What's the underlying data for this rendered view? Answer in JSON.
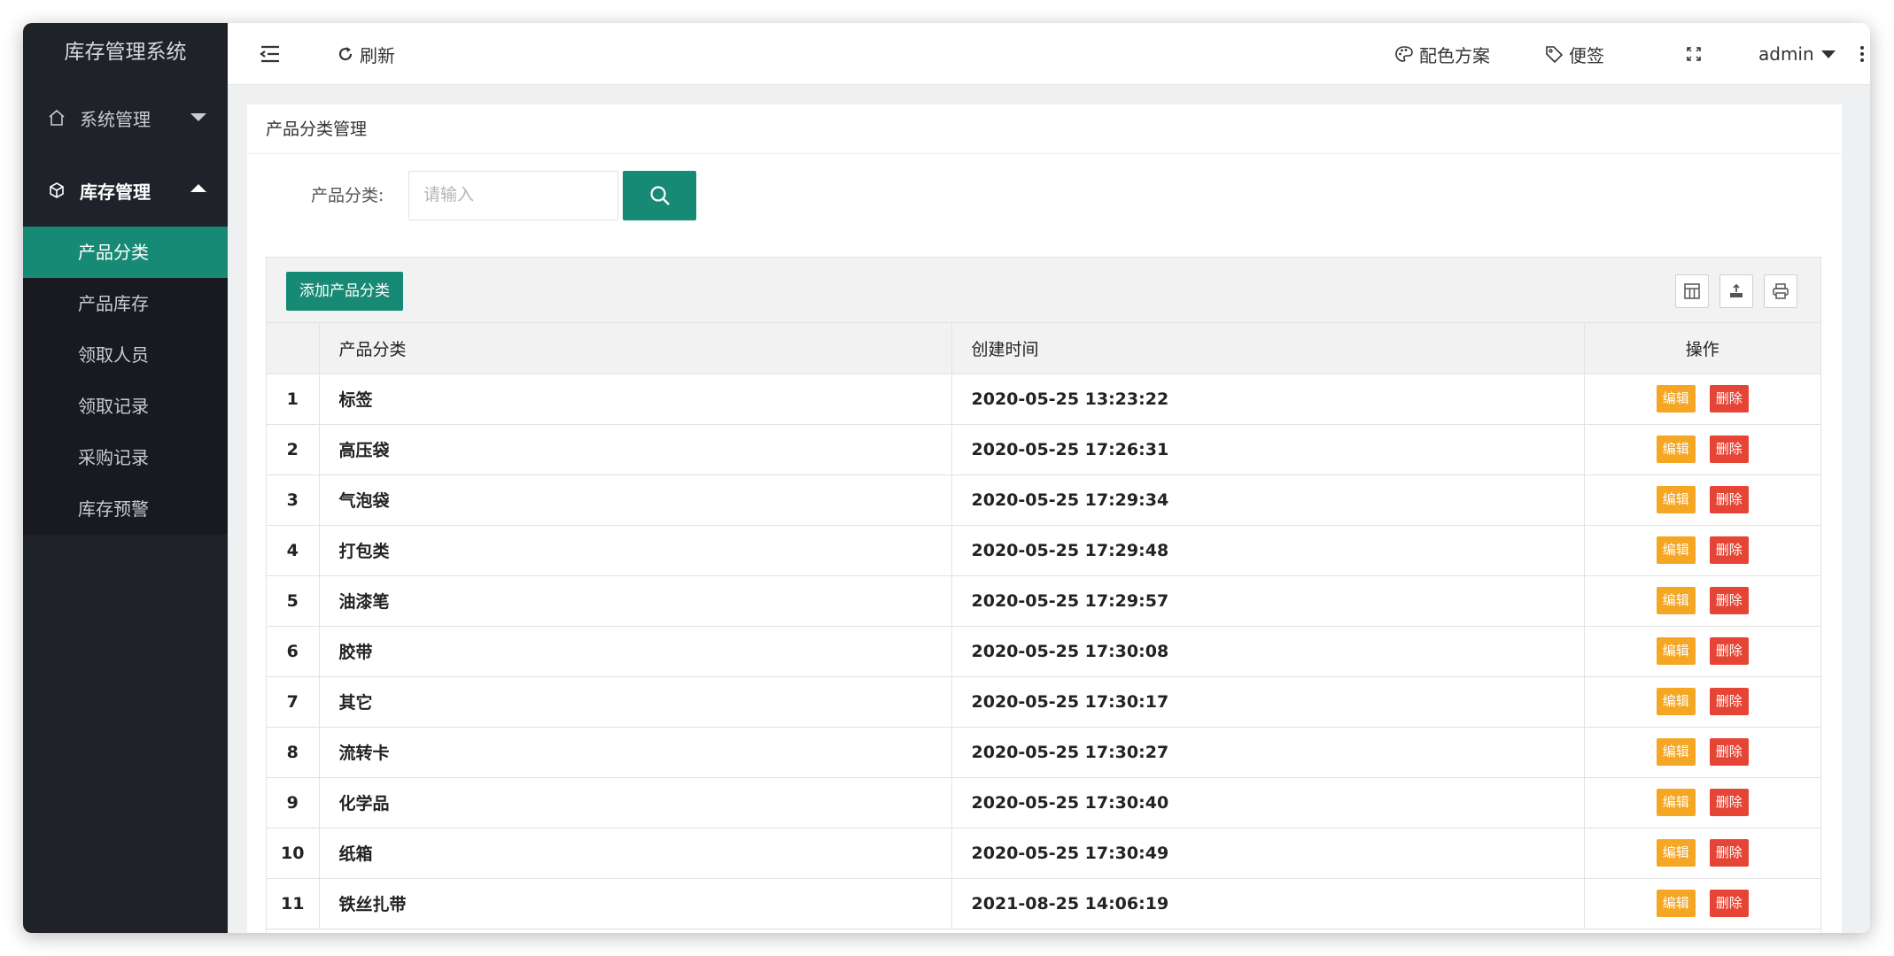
{
  "app": {
    "title": "库存管理系统"
  },
  "sidebar": {
    "groups": [
      {
        "label": "系统管理",
        "icon": "home-icon",
        "expanded": false
      },
      {
        "label": "库存管理",
        "icon": "cube-icon",
        "expanded": true,
        "items": [
          {
            "label": "产品分类",
            "active": true
          },
          {
            "label": "产品库存"
          },
          {
            "label": "领取人员"
          },
          {
            "label": "领取记录"
          },
          {
            "label": "采购记录"
          },
          {
            "label": "库存预警"
          }
        ]
      }
    ]
  },
  "header": {
    "refresh_label": "刷新",
    "theme_label": "配色方案",
    "notes_label": "便签",
    "user_label": "admin"
  },
  "panel": {
    "title": "产品分类管理"
  },
  "search": {
    "label": "产品分类:",
    "placeholder": "请输入"
  },
  "toolbar": {
    "add_label": "添加产品分类"
  },
  "table": {
    "columns": [
      "",
      "产品分类",
      "创建时间",
      "操作"
    ],
    "rows": [
      {
        "num": "1",
        "name": "标签",
        "created": "2020-05-25 13:23:22"
      },
      {
        "num": "2",
        "name": "高压袋",
        "created": "2020-05-25 17:26:31"
      },
      {
        "num": "3",
        "name": "气泡袋",
        "created": "2020-05-25 17:29:34"
      },
      {
        "num": "4",
        "name": "打包类",
        "created": "2020-05-25 17:29:48"
      },
      {
        "num": "5",
        "name": "油漆笔",
        "created": "2020-05-25 17:29:57"
      },
      {
        "num": "6",
        "name": "胶带",
        "created": "2020-05-25 17:30:08"
      },
      {
        "num": "7",
        "name": "其它",
        "created": "2020-05-25 17:30:17"
      },
      {
        "num": "8",
        "name": "流转卡",
        "created": "2020-05-25 17:30:27"
      },
      {
        "num": "9",
        "name": "化学品",
        "created": "2020-05-25 17:30:40"
      },
      {
        "num": "10",
        "name": "纸箱",
        "created": "2020-05-25 17:30:49"
      },
      {
        "num": "11",
        "name": "铁丝扎带",
        "created": "2021-08-25 14:06:19"
      }
    ],
    "edit_label": "编辑",
    "delete_label": "删除"
  },
  "colors": {
    "primary": "#168a74",
    "sidebar_bg": "#20222a",
    "edit": "#f5a623",
    "delete": "#e64434"
  }
}
